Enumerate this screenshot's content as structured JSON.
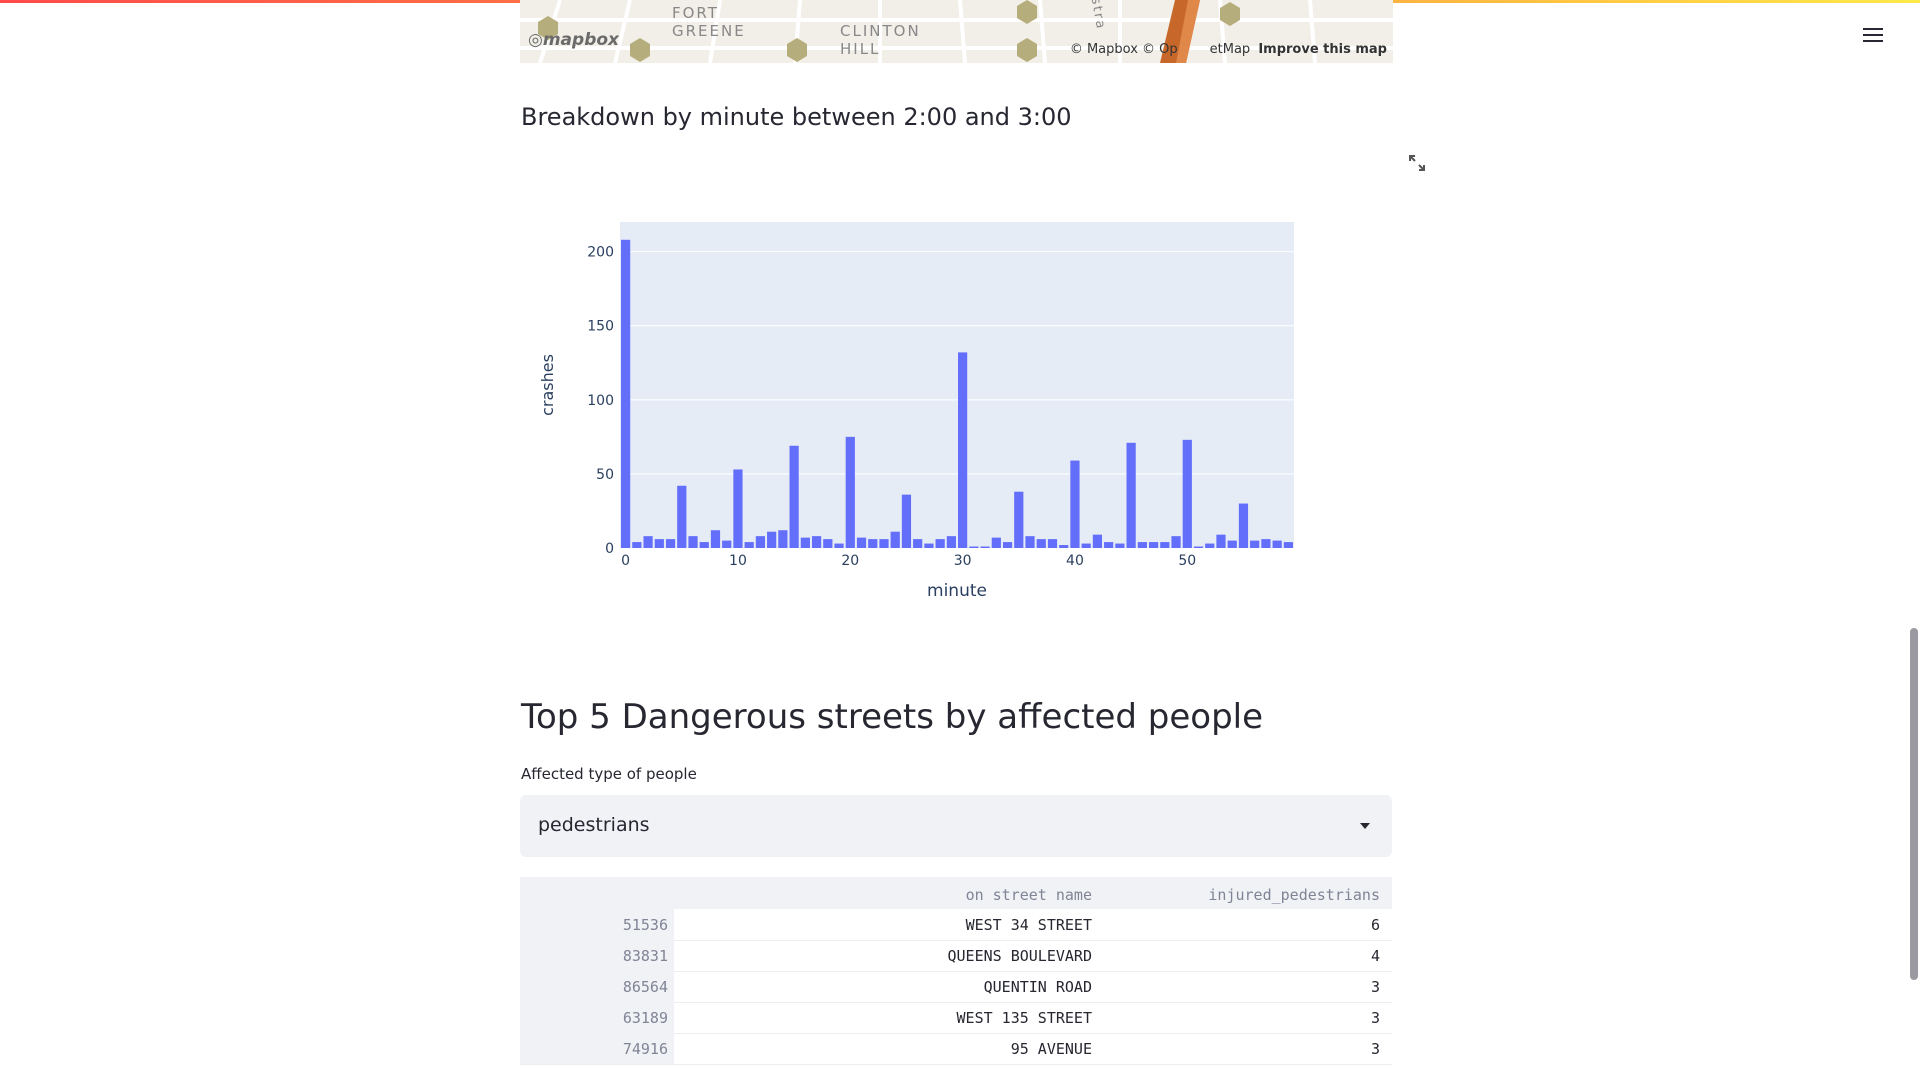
{
  "map": {
    "labels": [
      "FORT\nGREENE",
      "CLINTON\nHILL",
      "ostra"
    ],
    "logo": "mapbox",
    "attribution_prefix": "© Mapbox © Op",
    "attribution_suffix": "etMap",
    "improve_link": "Improve this map"
  },
  "chart_section": {
    "heading": "Breakdown by minute between 2:00 and 3:00",
    "expand_icon": "fullscreen-expand-icon"
  },
  "chart_data": {
    "type": "bar",
    "xlabel": "minute",
    "ylabel": "crashes",
    "x": [
      0,
      1,
      2,
      3,
      4,
      5,
      6,
      7,
      8,
      9,
      10,
      11,
      12,
      13,
      14,
      15,
      16,
      17,
      18,
      19,
      20,
      21,
      22,
      23,
      24,
      25,
      26,
      27,
      28,
      29,
      30,
      31,
      32,
      33,
      34,
      35,
      36,
      37,
      38,
      39,
      40,
      41,
      42,
      43,
      44,
      45,
      46,
      47,
      48,
      49,
      50,
      51,
      52,
      53,
      54,
      55,
      56,
      57,
      58,
      59
    ],
    "values": [
      208,
      4,
      8,
      6,
      6,
      42,
      8,
      4,
      12,
      5,
      53,
      4,
      8,
      11,
      12,
      69,
      7,
      8,
      6,
      3,
      75,
      7,
      6,
      6,
      11,
      36,
      6,
      3,
      6,
      8,
      132,
      1,
      1,
      7,
      4,
      38,
      8,
      6,
      6,
      2,
      59,
      3,
      9,
      4,
      3,
      71,
      4,
      4,
      4,
      8,
      73,
      1,
      3,
      9,
      5,
      30,
      5,
      6,
      5,
      4
    ],
    "xticks": [
      0,
      10,
      20,
      30,
      40,
      50
    ],
    "yticks": [
      0,
      50,
      100,
      150,
      200
    ],
    "xlim": [
      -0.5,
      59.5
    ],
    "ylim": [
      0,
      220
    ],
    "bar_color": "#636efa",
    "plot_bg": "#e5ecf6",
    "grid": true
  },
  "streets_section": {
    "title": "Top 5 Dangerous streets by affected people",
    "select_label": "Affected type of people",
    "select_value": "pedestrians",
    "table": {
      "columns": [
        "on street name",
        "injured_pedestrians"
      ],
      "rows": [
        {
          "index": "51536",
          "street": "WEST 34 STREET",
          "value": "6"
        },
        {
          "index": "83831",
          "street": "QUEENS BOULEVARD",
          "value": "4"
        },
        {
          "index": "86564",
          "street": "QUENTIN ROAD",
          "value": "3"
        },
        {
          "index": "63189",
          "street": "WEST 135 STREET",
          "value": "3"
        },
        {
          "index": "74916",
          "street": "95 AVENUE",
          "value": "3"
        }
      ]
    }
  }
}
